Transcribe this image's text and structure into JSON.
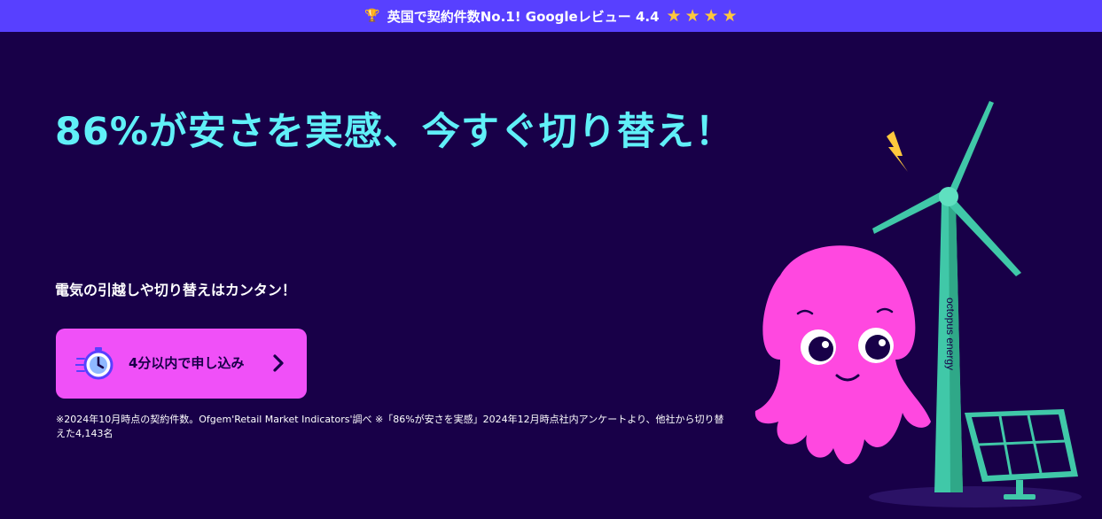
{
  "banner": {
    "trophy_icon": "trophy-icon",
    "text": "英国で契約件数No.1! Googleレビュー 4.4",
    "stars": [
      "★",
      "★",
      "★",
      "★"
    ],
    "star_color": "#ffc83d",
    "background": "#5840ff"
  },
  "hero": {
    "headline": "86%が安さを実感、今すぐ切り替え！",
    "subhead": "電気の引越しや切り替えはカンタン！",
    "cta": {
      "label": "4分以内で申し込み",
      "icon": "stopwatch-icon",
      "arrow_icon": "chevron-right-icon",
      "background": "#f050f8"
    },
    "footnote": "※2024年10月時点の契約件数。Ofgem'Retail Market Indicators'調べ ※「86%が安さを実感」2024年12月時点社内アンケートより、他社から切り替えた4,143名",
    "brand_text": "octopus energy"
  },
  "colors": {
    "page_background": "#180048",
    "headline": "#60f0f8",
    "octopus": "#ff48e0",
    "turbine": "#40c8a8"
  }
}
